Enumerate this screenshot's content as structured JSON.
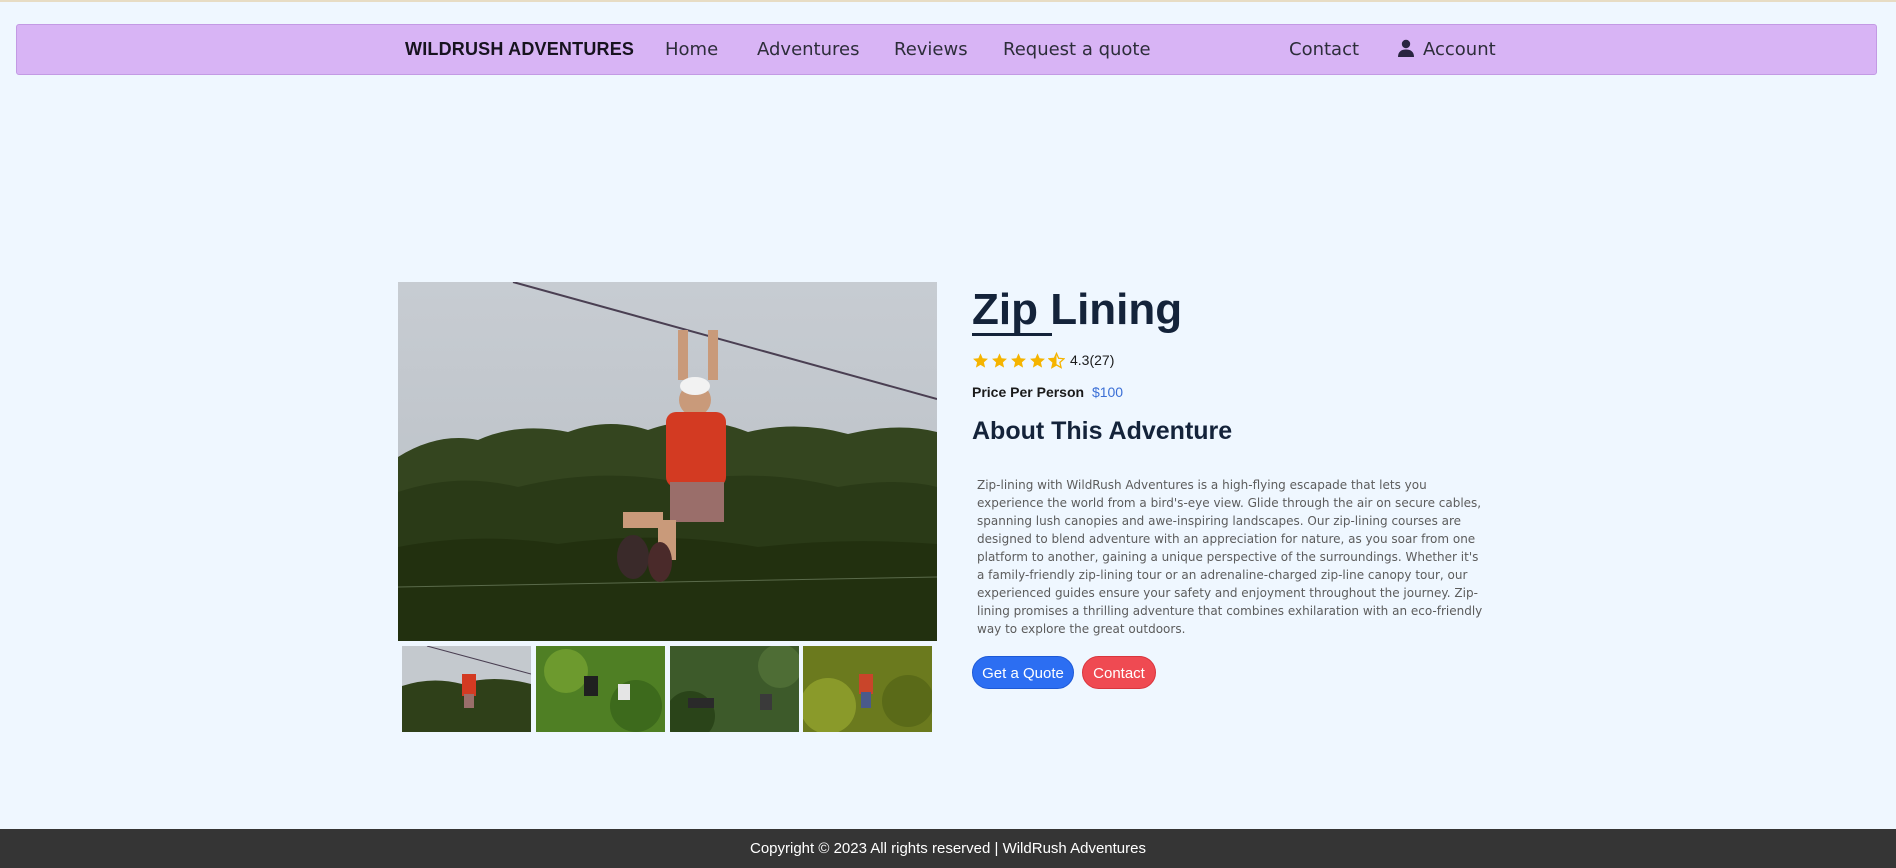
{
  "nav": {
    "brand": "WILDRUSH ADVENTURES",
    "links": [
      "Home",
      "Adventures",
      "Reviews",
      "Request a quote"
    ],
    "contact": "Contact",
    "account": "Account",
    "account_icon": "user-icon"
  },
  "adventure": {
    "title": "Zip Lining",
    "rating_value": 4.3,
    "rating_text": "4.3(27)",
    "price_label": "Price Per Person",
    "price": "$100",
    "about_heading": "About This Adventure",
    "description": "Zip-lining with WildRush Adventures is a high-flying escapade that lets you experience the world from a bird's-eye view. Glide through the air on secure cables, spanning lush canopies and awe-inspiring landscapes. Our zip-lining courses are designed to blend adventure with an appreciation for nature, as you soar from one platform to another, gaining a unique perspective of the surroundings. Whether it's a family-friendly zip-lining tour or an adrenaline-charged zip-line canopy tour, our experienced guides ensure your safety and enjoyment throughout the journey. Zip-lining promises a thrilling adventure that combines exhilaration with an eco-friendly way to explore the great outdoors.",
    "buttons": {
      "quote": "Get a Quote",
      "contact": "Contact"
    }
  },
  "colors": {
    "nav_bg": "#d8b4f5",
    "page_bg": "#eff7ff",
    "star": "#f5b400",
    "price": "#3b6fd6",
    "quote_button": "#2c6ef2",
    "contact_button": "#ef4a52",
    "footer_bg": "#353535"
  },
  "footer": {
    "text": "Copyright © 2023 All rights reserved | WildRush Adventures"
  }
}
